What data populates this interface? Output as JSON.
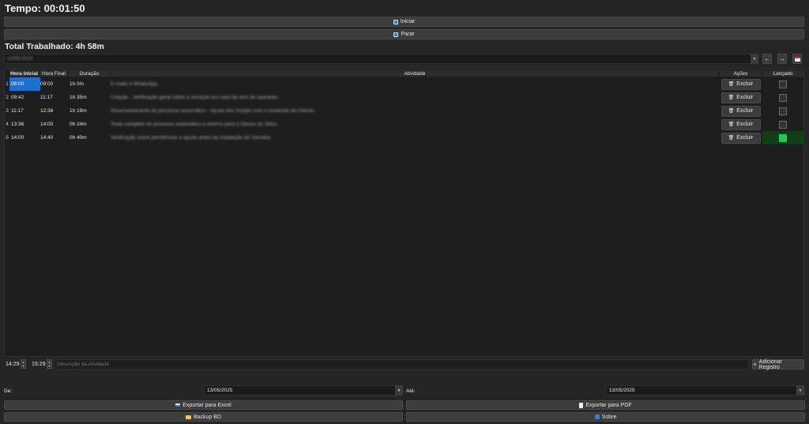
{
  "timer": {
    "label": "Tempo: 00:01:50"
  },
  "controls": {
    "start_label": "Iniciar",
    "stop_label": "Parar",
    "start_icon_color": "#2f7fd6",
    "stop_icon_color": "#2f7fd6"
  },
  "summary": {
    "total_label": "Total Trabalhado: 4h 58m"
  },
  "date_nav": {
    "date_value": "13/05/2025",
    "prev_label": "←",
    "next_label": "→"
  },
  "table": {
    "columns": [
      "Hora Inicial",
      "Hora Final",
      "Duração",
      "Atividade",
      "Ações",
      "Lançado"
    ],
    "delete_label": "Excluir",
    "rows": [
      {
        "num": "1",
        "start": "08:00",
        "end": "09:00",
        "duration": "1h 0m",
        "activity": "E-mails e WhatsApp.",
        "launched": false
      },
      {
        "num": "2",
        "start": "09:42",
        "end": "11:17",
        "duration": "1h 35m",
        "activity": "Criação - Verificação geral sobre a situação em caso de erro de operador.",
        "launched": false
      },
      {
        "num": "3",
        "start": "11:17",
        "end": "12:36",
        "duration": "1h 19m",
        "activity": "Desenvolvimento do processo automático - Ajuste dos Scripts com o conteúdo do Cliente.",
        "launched": false
      },
      {
        "num": "4",
        "start": "13:36",
        "end": "14:00",
        "duration": "0h 24m",
        "activity": "Teste completo do processo automático e retorno para o Gestor do Setor.",
        "launched": false
      },
      {
        "num": "5",
        "start": "14:00",
        "end": "14:40",
        "duration": "0h 40m",
        "activity": "Verificação sobre pendências e ajuste antes da instalação do Servidor.",
        "launched": true
      }
    ],
    "launched_on_color": "#22c55e",
    "launched_bg_color": "#0f3f17",
    "selected_color": "#1f6fd1"
  },
  "new_entry": {
    "start_time": "14:29",
    "end_time": "15:29",
    "description_placeholder": "Descrição da Atividade",
    "add_label": "Adicionar Registro"
  },
  "export": {
    "from_label": "De:",
    "from_date": "13/05/2025",
    "to_label": "Até:",
    "to_date": "13/05/2025",
    "excel_label": "Exportar para Excel",
    "pdf_label": "Exportar para PDF",
    "backup_label": "Backup BD",
    "about_label": "Sobre"
  }
}
